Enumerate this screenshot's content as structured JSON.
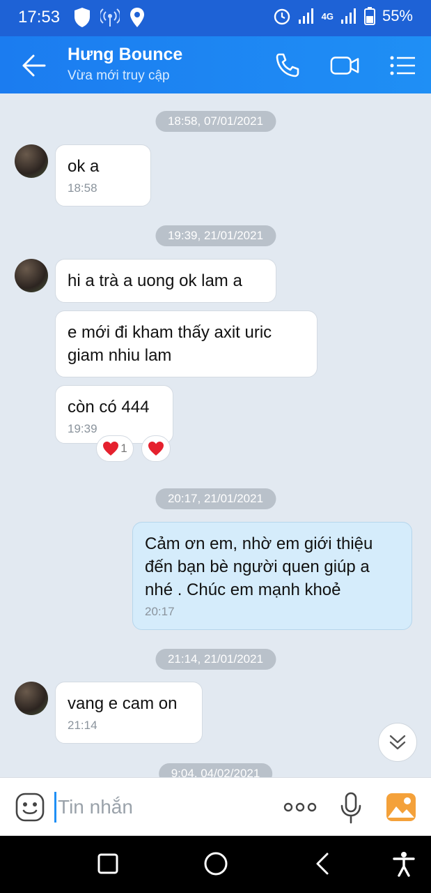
{
  "status_bar": {
    "time": "17:53",
    "battery": "55%",
    "network": "4G",
    "icons": [
      "shield-icon",
      "hotspot-icon",
      "location-icon",
      "alarm-icon",
      "signal-icon",
      "signal-icon",
      "battery-icon"
    ]
  },
  "header": {
    "contact_name": "Hưng Bounce",
    "contact_status": "Vừa mới truy cập",
    "icons": [
      "back-arrow-icon",
      "phone-icon",
      "video-call-icon",
      "menu-list-icon"
    ]
  },
  "chat": {
    "dates": [
      "18:58, 07/01/2021",
      "19:39, 21/01/2021",
      "20:17, 21/01/2021",
      "21:14, 21/01/2021",
      "9:04, 04/02/2021"
    ],
    "messages": [
      {
        "text": "ok a",
        "time": "18:58",
        "direction": "in"
      },
      {
        "text": "hi a trà a uong ok lam a",
        "direction": "in"
      },
      {
        "text": "e mới đi kham thấy axit uric giam nhiu lam",
        "direction": "in"
      },
      {
        "text": "còn có 444",
        "time": "19:39",
        "direction": "in"
      },
      {
        "text": "Cảm ơn em, nhờ em giới thiệu đến bạn bè người quen giúp a nhé . Chúc em mạnh khoẻ",
        "time": "20:17",
        "direction": "out"
      },
      {
        "text": "vang e cam on",
        "time": "21:14",
        "direction": "in"
      }
    ],
    "reactions": {
      "heart_count": "1"
    }
  },
  "input": {
    "placeholder": "Tin nhắn"
  },
  "colors": {
    "status_bar": "#1e62d6",
    "header": "#1f8ff5",
    "chat_bg": "#e2e9f1",
    "outgoing_bubble": "#d5ecfb",
    "heart": "#e5212e"
  }
}
